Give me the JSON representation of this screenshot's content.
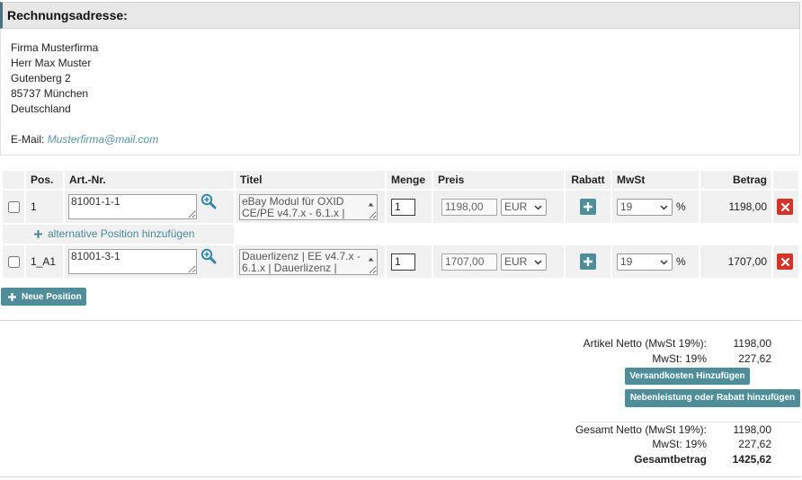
{
  "billing_address": {
    "title": "Rechnungsadresse:",
    "lines": [
      "Firma Musterfirma",
      "Herr Max Muster",
      "Gutenberg 2",
      "85737 München",
      "Deutschland"
    ],
    "email_label": "E-Mail:",
    "email": "Musterfirma@mail.com"
  },
  "items": {
    "headers": {
      "pos": "Pos.",
      "art_nr": "Art.-Nr.",
      "titel": "Titel",
      "menge": "Menge",
      "preis": "Preis",
      "rabatt": "Rabatt",
      "mwst": "MwSt",
      "betrag": "Betrag"
    },
    "rows": [
      {
        "checked": false,
        "pos": "1",
        "art_nr": "81001-1-1",
        "titel": "eBay Modul für OXID CE/PE v4.7.x - 6.1.x |",
        "menge": "1",
        "preis": "1198,00",
        "currency": "EUR",
        "mwst": "19",
        "mwst_unit": "%",
        "betrag": "1198,00"
      },
      {
        "checked": false,
        "pos": "1_A1",
        "art_nr": "81001-3-1",
        "titel": "Dauerlizenz | EE v4.7.x - 6.1.x | Dauerlizenz |",
        "menge": "1",
        "preis": "1707,00",
        "currency": "EUR",
        "mwst": "19",
        "mwst_unit": "%",
        "betrag": "1707,00"
      }
    ],
    "alternative_link": "alternative Position hinzufügen",
    "new_position_label": "Neue Position"
  },
  "totals": {
    "artikel_netto_label": "Artikel Netto (MwSt 19%):",
    "artikel_netto": "1198,00",
    "mwst_label": "MwSt: 19%",
    "mwst": "227,62",
    "versandkosten_button": "Versandkosten Hinzufügen",
    "nebenleistung_button": "Nebenleistung oder Rabatt hinzufügen",
    "gesamt_netto_label": "Gesamt Netto (MwSt 19%):",
    "gesamt_netto": "1198,00",
    "gesamt_mwst_label": "MwSt: 19%",
    "gesamt_mwst": "227,62",
    "gesamtbetrag_label": "Gesamtbetrag",
    "gesamtbetrag": "1425,62"
  },
  "icons": {
    "article_search": "zoom-in-icon",
    "add_discount": "plus-icon",
    "delete_row": "close-icon",
    "add": "plus-icon",
    "dropdown": "chevron-down-icon",
    "textarea_scroll": "scroll-up-arrow-icon"
  },
  "colors": {
    "accent": "#4f8e99",
    "link": "#4a8a96",
    "email": "#5b93a0",
    "search": "#2f8aa6",
    "delete": "#d3352b",
    "section_border": "#4b7282"
  }
}
